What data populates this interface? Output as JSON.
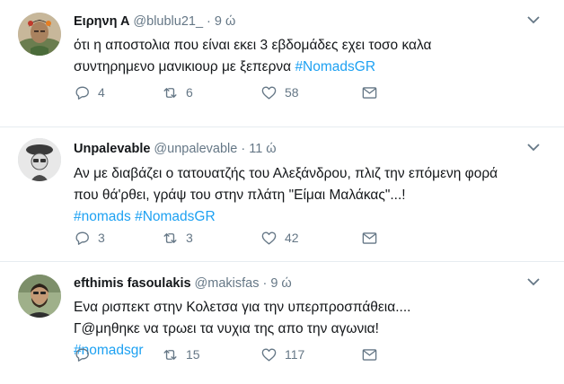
{
  "tweets": [
    {
      "name": "Ειρηνη Α",
      "handle": "@blublu21_",
      "separator": "·",
      "time": "9 ώ",
      "line1": "ότι η αποστολια που είναι εκει 3 εβδομάδες εχει τοσο καλα",
      "line2_text": "συντηρημενο μανικιουρ με ξεπερνα  ",
      "hashtag1": "#NomadsGR",
      "hashtag2": "",
      "replies": "4",
      "retweets": "6",
      "likes": "58"
    },
    {
      "name": "Unpalevable",
      "handle": "@unpalevable",
      "separator": "·",
      "time": "11 ώ",
      "line1": "Αν με διαβάζει ο τατουατζής του Αλεξάνδρου, πλιζ την επόμενη φορά",
      "line2_text": "που θά'ρθει, γράψ του στην πλάτη \"Είμαι Μαλάκας\"...!",
      "hashtag1": "#nomads",
      "hashtag2": "#NomadsGR",
      "replies": "3",
      "retweets": "3",
      "likes": "42"
    },
    {
      "name": "efthimis fasoulakis",
      "handle": "@makisfas",
      "separator": "·",
      "time": "9 ώ",
      "line1": "Ενα ρισπεκτ στην Κολετσα για την υπερπροσπάθεια....",
      "line2_text": "Γ@μηθηκε να τρωει τα νυχια της απο την αγωνια!",
      "hashtag1": "#nomadsgr",
      "hashtag2": "",
      "replies": "",
      "retweets": "15",
      "likes": "117"
    }
  ],
  "icons": {
    "reply": "reply-icon",
    "retweet": "retweet-icon",
    "like": "heart-icon",
    "dm": "envelope-icon",
    "caret": "chevron-down-icon"
  },
  "colors": {
    "link": "#1da1f2",
    "muted": "#657786",
    "text": "#14171a",
    "divider": "#e6ecf0"
  }
}
